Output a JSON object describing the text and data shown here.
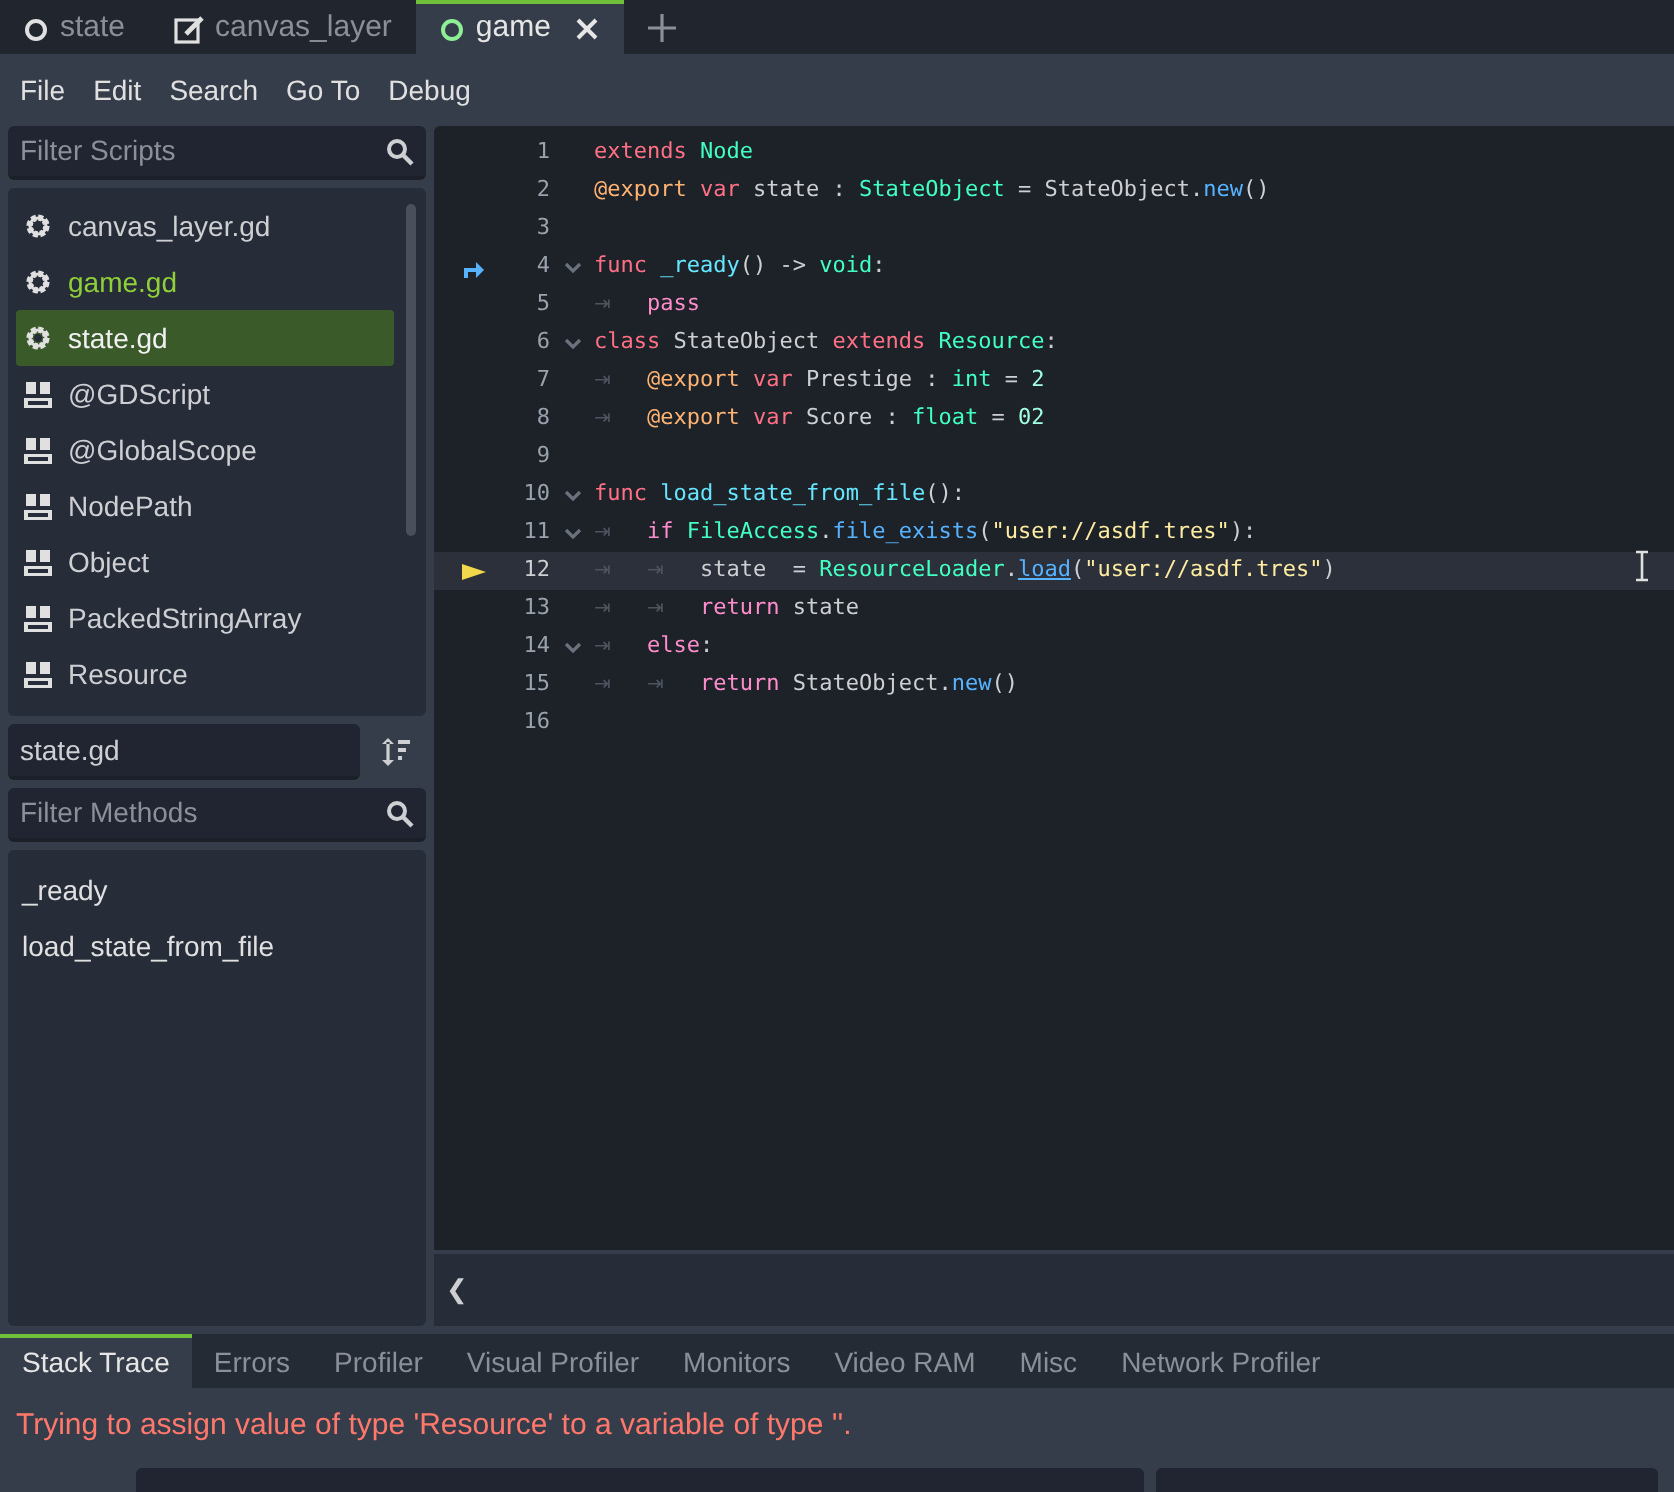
{
  "tabs": [
    {
      "label": "state",
      "kind": "scene",
      "selected": false,
      "closable": false
    },
    {
      "label": "canvas_layer",
      "kind": "script",
      "selected": false,
      "closable": false
    },
    {
      "label": "game",
      "kind": "scene",
      "selected": true,
      "closable": true
    }
  ],
  "menu": [
    "File",
    "Edit",
    "Search",
    "Go To",
    "Debug"
  ],
  "scripts_filter": {
    "placeholder": "Filter Scripts"
  },
  "scripts": [
    {
      "label": "canvas_layer.gd",
      "kind": "script",
      "selected": false,
      "active": false
    },
    {
      "label": "game.gd",
      "kind": "script",
      "selected": false,
      "active": true
    },
    {
      "label": "state.gd",
      "kind": "script",
      "selected": true,
      "active": false
    },
    {
      "label": "@GDScript",
      "kind": "doc",
      "selected": false,
      "active": false
    },
    {
      "label": "@GlobalScope",
      "kind": "doc",
      "selected": false,
      "active": false
    },
    {
      "label": "NodePath",
      "kind": "doc",
      "selected": false,
      "active": false
    },
    {
      "label": "Object",
      "kind": "doc",
      "selected": false,
      "active": false
    },
    {
      "label": "PackedStringArray",
      "kind": "doc",
      "selected": false,
      "active": false
    },
    {
      "label": "Resource",
      "kind": "doc",
      "selected": false,
      "active": false
    }
  ],
  "current_script": "state.gd",
  "methods_filter": {
    "placeholder": "Filter Methods"
  },
  "methods": [
    "_ready",
    "load_state_from_file"
  ],
  "code": [
    {
      "number": "1",
      "fold": false,
      "current": false,
      "tokens": [
        {
          "t": "extends ",
          "kind": "keyword"
        },
        {
          "t": "Node",
          "kind": "type"
        }
      ]
    },
    {
      "number": "2",
      "fold": false,
      "current": false,
      "tokens": [
        {
          "t": "@export ",
          "kind": "annotation"
        },
        {
          "t": "var ",
          "kind": "keyword"
        },
        {
          "t": "state : ",
          "kind": "plain"
        },
        {
          "t": "StateObject",
          "kind": "type"
        },
        {
          "t": " = StateObject.",
          "kind": "plain"
        },
        {
          "t": "new",
          "kind": "call"
        },
        {
          "t": "()",
          "kind": "plain"
        }
      ]
    },
    {
      "number": "3",
      "fold": false,
      "current": false
    },
    {
      "number": "4",
      "fold": true,
      "gutter": {
        "kind": "connection"
      },
      "current": false,
      "tokens": [
        {
          "t": "func ",
          "kind": "keyword"
        },
        {
          "t": "_ready",
          "kind": "define"
        },
        {
          "t": "() -> ",
          "kind": "plain"
        },
        {
          "t": "void",
          "kind": "type"
        },
        {
          "t": ":",
          "kind": "plain"
        }
      ]
    },
    {
      "number": "5",
      "tabs": [
        "⇥"
      ],
      "fold": false,
      "current": false,
      "tokens": [
        {
          "t": "pass",
          "kind": "control"
        }
      ]
    },
    {
      "number": "6",
      "fold": true,
      "current": false,
      "tokens": [
        {
          "t": "class ",
          "kind": "keyword"
        },
        {
          "t": "StateObject ",
          "kind": "plain"
        },
        {
          "t": "extends ",
          "kind": "keyword"
        },
        {
          "t": "Resource",
          "kind": "type"
        },
        {
          "t": ":",
          "kind": "plain"
        }
      ]
    },
    {
      "number": "7",
      "tabs": [
        "⇥"
      ],
      "fold": false,
      "current": false,
      "tokens": [
        {
          "t": "@export ",
          "kind": "annotation"
        },
        {
          "t": "var ",
          "kind": "keyword"
        },
        {
          "t": "Prestige : ",
          "kind": "plain"
        },
        {
          "t": "int",
          "kind": "type"
        },
        {
          "t": " = ",
          "kind": "plain"
        },
        {
          "t": "2",
          "kind": "number"
        }
      ]
    },
    {
      "number": "8",
      "tabs": [
        "⇥"
      ],
      "fold": false,
      "current": false,
      "tokens": [
        {
          "t": "@export ",
          "kind": "annotation"
        },
        {
          "t": "var ",
          "kind": "keyword"
        },
        {
          "t": "Score : ",
          "kind": "plain"
        },
        {
          "t": "float",
          "kind": "type"
        },
        {
          "t": " = ",
          "kind": "plain"
        },
        {
          "t": "02",
          "kind": "number"
        }
      ]
    },
    {
      "number": "9",
      "fold": false,
      "current": false
    },
    {
      "number": "10",
      "fold": true,
      "current": false,
      "tokens": [
        {
          "t": "func ",
          "kind": "keyword"
        },
        {
          "t": "load_state_from_file",
          "kind": "define"
        },
        {
          "t": "():",
          "kind": "plain"
        }
      ]
    },
    {
      "number": "11",
      "tabs": [
        "⇥"
      ],
      "fold": true,
      "current": false,
      "tokens": [
        {
          "t": "if ",
          "kind": "control"
        },
        {
          "t": "FileAccess",
          "kind": "type"
        },
        {
          "t": ".",
          "kind": "plain"
        },
        {
          "t": "file_exists",
          "kind": "call"
        },
        {
          "t": "(",
          "kind": "plain"
        },
        {
          "t": "\"user://asdf.tres\"",
          "kind": "string"
        },
        {
          "t": "):",
          "kind": "plain"
        }
      ]
    },
    {
      "number": "12",
      "tabs": [
        "⇥",
        "⇥"
      ],
      "fold": false,
      "gutter": {
        "kind": "execution"
      },
      "current": true,
      "tokens": [
        {
          "t": "state  = ",
          "kind": "plain"
        },
        {
          "t": "ResourceLoader",
          "kind": "type"
        },
        {
          "t": ".",
          "kind": "plain"
        },
        {
          "t": "load",
          "kind": "call"
        },
        {
          "t": "(",
          "kind": "plain"
        },
        {
          "t": "\"user://asdf.tres\"",
          "kind": "string"
        },
        {
          "t": ")",
          "kind": "plain"
        }
      ]
    },
    {
      "number": "13",
      "tabs": [
        "⇥",
        "⇥"
      ],
      "fold": false,
      "current": false,
      "tokens": [
        {
          "t": "return ",
          "kind": "control"
        },
        {
          "t": "state",
          "kind": "plain"
        }
      ]
    },
    {
      "number": "14",
      "tabs": [
        "⇥"
      ],
      "fold": true,
      "current": false,
      "tokens": [
        {
          "t": "else",
          "kind": "control"
        },
        {
          "t": ":",
          "kind": "plain"
        }
      ]
    },
    {
      "number": "15",
      "tabs": [
        "⇥",
        "⇥"
      ],
      "fold": false,
      "current": false,
      "tokens": [
        {
          "t": "return ",
          "kind": "control"
        },
        {
          "t": "StateObject.",
          "kind": "plain"
        },
        {
          "t": "new",
          "kind": "call"
        },
        {
          "t": "()",
          "kind": "plain"
        }
      ]
    },
    {
      "number": "16",
      "fold": false,
      "current": false
    }
  ],
  "collapse_button": "❮",
  "debug_tabs": [
    {
      "label": "Stack Trace",
      "selected": true
    },
    {
      "label": "Errors",
      "selected": false
    },
    {
      "label": "Profiler",
      "selected": false
    },
    {
      "label": "Visual Profiler",
      "selected": false
    },
    {
      "label": "Monitors",
      "selected": false
    },
    {
      "label": "Video RAM",
      "selected": false
    },
    {
      "label": "Misc",
      "selected": false
    },
    {
      "label": "Network Profiler",
      "selected": false
    }
  ],
  "error_message": "Trying to assign value of type 'Resource' to a variable of type ''."
}
